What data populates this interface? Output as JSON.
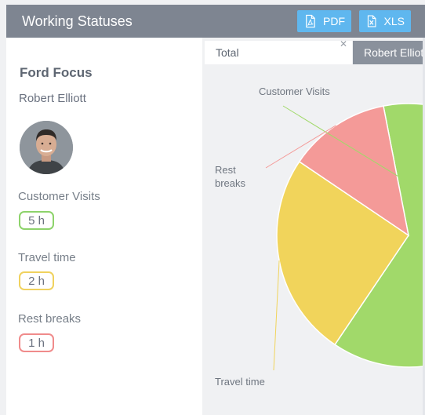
{
  "header": {
    "title": "Working Statuses",
    "pdf_label": "PDF",
    "xls_label": "XLS"
  },
  "left": {
    "vehicle": "Ford Focus",
    "driver": "Robert Elliott",
    "stats": [
      {
        "label": "Customer Visits",
        "value": "5 h",
        "color": "#8dd36b"
      },
      {
        "label": "Travel time",
        "value": "2 h",
        "color": "#f0d25e"
      },
      {
        "label": "Rest breaks",
        "value": "1 h",
        "color": "#f08b8b"
      }
    ]
  },
  "tabs": [
    {
      "label": "Total",
      "active": true
    },
    {
      "label": "Robert Elliott",
      "active": false
    }
  ],
  "chart_data": {
    "type": "pie",
    "title": "",
    "slices": [
      {
        "label": "Customer Visits",
        "value": 5,
        "color": "#a1d96a"
      },
      {
        "label": "Travel time",
        "value": 2,
        "color": "#f1d45b"
      },
      {
        "label": "Rest breaks",
        "value": 1,
        "color": "#f49a98"
      }
    ],
    "legend": "none"
  }
}
